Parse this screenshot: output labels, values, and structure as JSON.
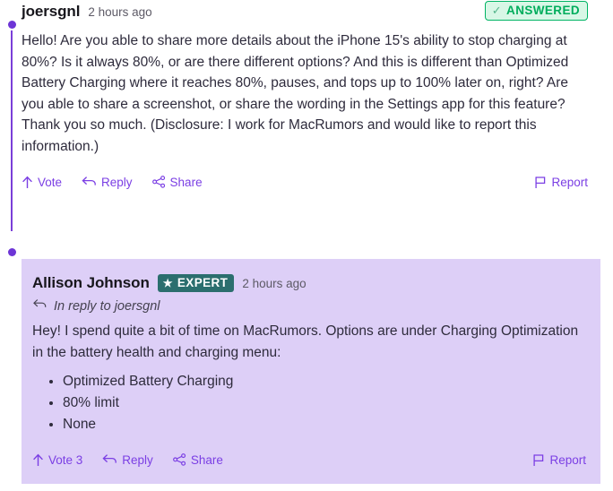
{
  "thread": {
    "accent_color": "#7b3fe4",
    "card_background": "#ddcff7",
    "text_color": "#2e2b3c"
  },
  "comments": [
    {
      "author": "joersgnl",
      "timestamp": "2 hours ago",
      "badge": {
        "label": "ANSWERED",
        "icon": "check-icon",
        "color": "#00ad5c",
        "background": "#d8f7e6"
      },
      "body": "Hello! Are you able to share more details about the iPhone 15's ability to stop charging at 80%? Is it always 80%, or are there different options? And this is different than Optimized Battery Charging where it reaches 80%, pauses, and tops up to 100% later on, right? Are you able to share a screenshot, or share the wording in the Settings app for this feature? Thank you so much. (Disclosure: I work for MacRumors and would like to report this information.)",
      "actions": {
        "vote": "Vote",
        "reply": "Reply",
        "share": "Share",
        "report": "Report"
      }
    },
    {
      "author": "Allison Johnson",
      "timestamp": "2 hours ago",
      "badge": {
        "label": "EXPERT",
        "icon": "star-icon",
        "color": "#ffffff",
        "background": "#2b6e6e"
      },
      "in_reply_to": "In reply to joersgnl",
      "body_intro": "Hey! I spend quite a bit of time on MacRumors. Options are under Charging Optimization in the battery health and charging menu:",
      "bullets": [
        "Optimized Battery Charging",
        "80% limit",
        "None"
      ],
      "actions": {
        "vote": "Vote 3",
        "reply": "Reply",
        "share": "Share",
        "report": "Report"
      }
    }
  ]
}
